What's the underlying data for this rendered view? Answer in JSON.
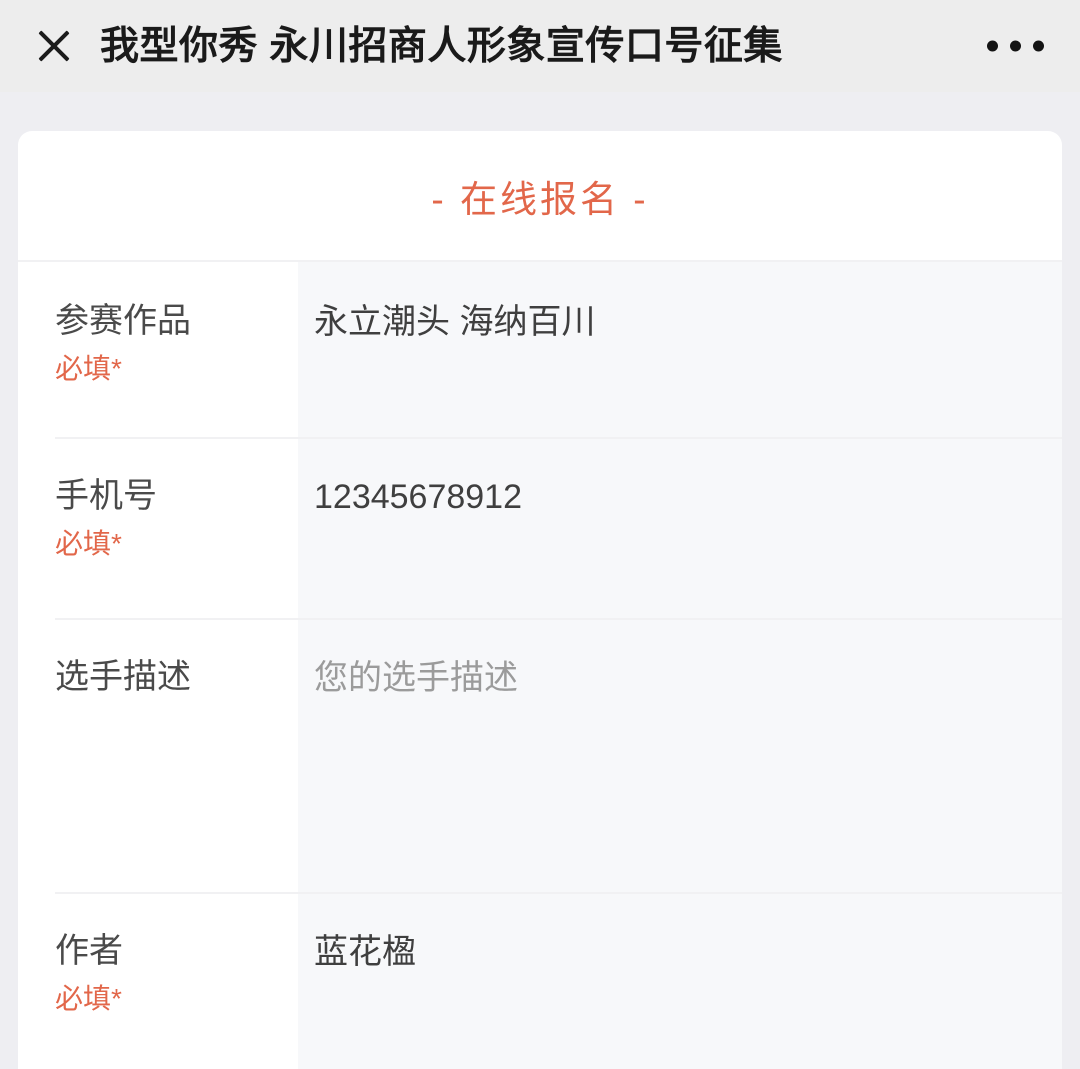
{
  "navbar": {
    "close_icon": "close-icon",
    "title": "我型你秀 永川招商人形象宣传口号征集",
    "more_icon": "more-dots-icon"
  },
  "card": {
    "header": "- 在线报名 -",
    "accent_color": "#e2674a",
    "rows": [
      {
        "label": "参赛作品",
        "required_text": "必填*",
        "required": true,
        "value": "永立潮头 海纳百川",
        "is_placeholder": false
      },
      {
        "label": "手机号",
        "required_text": "必填*",
        "required": true,
        "value": "12345678912",
        "is_placeholder": false
      },
      {
        "label": "选手描述",
        "required_text": "",
        "required": false,
        "value": "您的选手描述",
        "is_placeholder": true
      },
      {
        "label": "作者",
        "required_text": "必填*",
        "required": true,
        "value": "蓝花楹",
        "is_placeholder": false
      }
    ]
  }
}
